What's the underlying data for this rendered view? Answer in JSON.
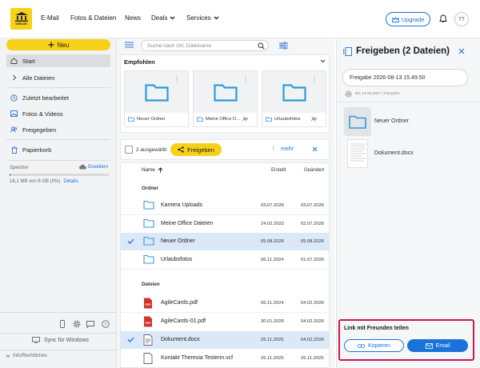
{
  "logo": {
    "text": "WEB.DE"
  },
  "topnav": {
    "email": "E-Mail",
    "fotos": "Fotos & Dateien",
    "news": "News",
    "deals": "Deals",
    "services": "Services",
    "upgrade": "Upgrade",
    "avatar": "TT"
  },
  "sidebar": {
    "neu": "Neu",
    "items": [
      {
        "label": "Start",
        "icon": "home-icon"
      },
      {
        "label": "Alle Dateien",
        "icon": "chevron-right-icon"
      },
      {
        "label": "Zuletzt bearbeitet",
        "icon": "clock-icon"
      },
      {
        "label": "Fotos & Videos",
        "icon": "image-icon"
      },
      {
        "label": "Freigegeben",
        "icon": "users-icon"
      },
      {
        "label": "Papierkorb",
        "icon": "trash-icon"
      }
    ],
    "storage_label": "Speicher",
    "erweitern": "Erweitern",
    "storage_used": "16,1 MB von 6 GB (0%)",
    "storage_fraction": 0.003,
    "details": "Details",
    "sync": "Sync für Windows",
    "info": "Info/Rechtliches"
  },
  "main": {
    "search_placeholder": "Suche nach Ort, Dateiname",
    "empfohlen": "Empfohlen",
    "cards": [
      {
        "label": "Neuer Ordner"
      },
      {
        "label": "Meine Office D..."
      },
      {
        "label": "Urlaubsfotos"
      }
    ],
    "selection_count": "2 ausgewählt",
    "freigeben": "Freigeben",
    "mehr": "mehr",
    "col_name": "Name",
    "col_erstellt": "Erstellt",
    "col_geaendert": "Geändert",
    "section_ordner": "Ordner",
    "section_dateien": "Dateien",
    "folders": [
      {
        "name": "Kamera Uploads",
        "created": "03.07.2026",
        "modified": "03.07.2026",
        "selected": false
      },
      {
        "name": "Meine Office Dateien",
        "created": "24.02.2022",
        "modified": "02.07.2026",
        "selected": false
      },
      {
        "name": "Neuer Ordner",
        "created": "05.08.2026",
        "modified": "05.08.2026",
        "selected": true
      },
      {
        "name": "Urlaubsfotos",
        "created": "06.11.2024",
        "modified": "01.07.2026",
        "selected": false
      }
    ],
    "files": [
      {
        "name": "AgileCards.pdf",
        "created": "05.11.2024",
        "modified": "04.02.2026",
        "type": "pdf",
        "selected": false
      },
      {
        "name": "AgileCards-01.pdf",
        "created": "30.01.2025",
        "modified": "04.02.2026",
        "type": "pdf",
        "selected": false
      },
      {
        "name": "Dokument.docx",
        "created": "26.11.2025",
        "modified": "04.02.2026",
        "type": "doc",
        "selected": true
      },
      {
        "name": "Kontakt Theresia Testerin.vcf",
        "created": "26.11.2025",
        "modified": "26.11.2025",
        "type": "doc",
        "selected": false
      }
    ]
  },
  "panel": {
    "title": "Freigeben (2 Dateien)",
    "share_name": "Freigabe 2026-08-13 15.49.50",
    "expiry": "Bis 13.09.2027 | Inkognito",
    "items": [
      {
        "name": "Neuer Ordner"
      },
      {
        "name": "Dokument.docx"
      }
    ],
    "link_title": "Link mit Freunden teilen",
    "kopieren": "Kopieren",
    "email": "Email"
  },
  "colors": {
    "accent": "#f7d117",
    "blue": "#1a73d9",
    "folder": "#2f9bd8",
    "pdf": "#d0342c",
    "highlight": "#c8194a"
  }
}
